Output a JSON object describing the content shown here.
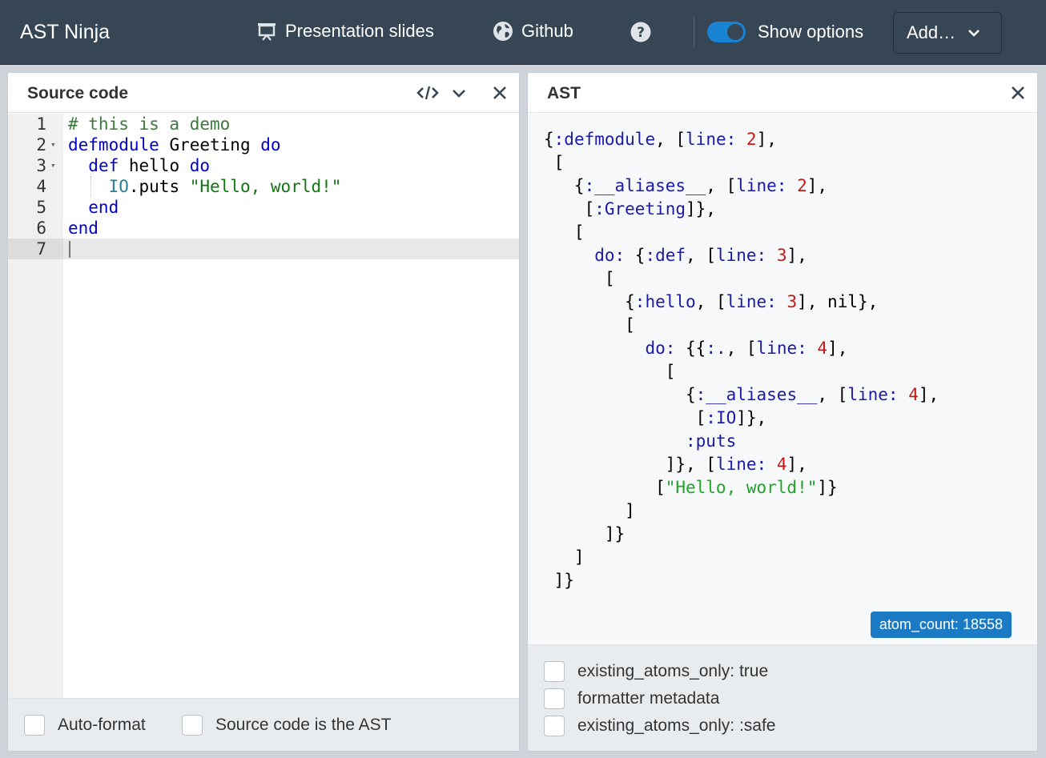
{
  "app": {
    "title": "AST Ninja"
  },
  "header": {
    "nav": [
      {
        "label": "Presentation slides",
        "icon": "presentation-icon"
      },
      {
        "label": "Github",
        "icon": "globe-icon"
      }
    ],
    "help_icon": "question-circle-icon",
    "show_options_label": "Show options",
    "show_options_on": true,
    "add_label": "Add…"
  },
  "source_panel": {
    "title": "Source code",
    "lines": [
      {
        "num": "1",
        "text": "# this is a demo"
      },
      {
        "num": "2",
        "text": "defmodule Greeting do"
      },
      {
        "num": "3",
        "text": "  def hello do"
      },
      {
        "num": "4",
        "text": "    IO.puts \"Hello, world!\""
      },
      {
        "num": "5",
        "text": "  end"
      },
      {
        "num": "6",
        "text": "end"
      },
      {
        "num": "7",
        "text": ""
      }
    ],
    "options": [
      {
        "label": "Auto-format",
        "checked": false
      },
      {
        "label": "Source code is the AST",
        "checked": false
      }
    ]
  },
  "ast_panel": {
    "title": "AST",
    "lines": [
      "{:defmodule, [line: 2],",
      " [",
      "   {:__aliases__, [line: 2],",
      "    [:Greeting]},",
      "   [",
      "     do: {:def, [line: 3],",
      "      [",
      "        {:hello, [line: 3], nil},",
      "        [",
      "          do: {{:., [line: 4],",
      "            [",
      "              {:__aliases__, [line: 4],",
      "               [:IO]},",
      "              :puts",
      "            ]}, [line: 4],",
      "           [\"Hello, world!\"]}",
      "        ]",
      "      ]}",
      "   ]",
      " ]}"
    ],
    "badge": "atom_count: 18558",
    "options": [
      {
        "label": "existing_atoms_only: true",
        "checked": false
      },
      {
        "label": "formatter metadata",
        "checked": false
      },
      {
        "label": "existing_atoms_only: :safe",
        "checked": false
      }
    ]
  },
  "colors": {
    "topbar": "#364654",
    "accent": "#1a84d4",
    "keyword": "#0000cc",
    "atom": "#1a1aa6",
    "number": "#c41a16",
    "string": "#22a32a"
  }
}
